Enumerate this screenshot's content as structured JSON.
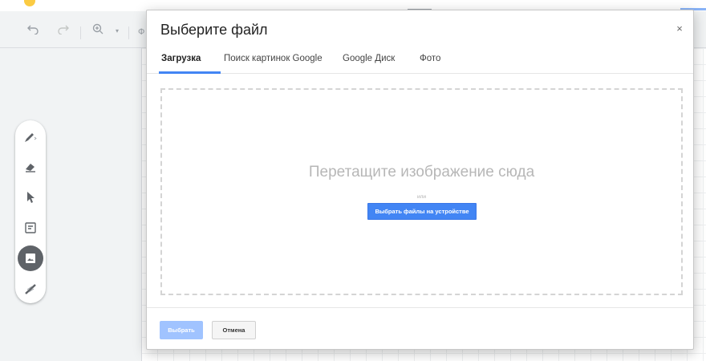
{
  "toolbar": {
    "undo_icon": "undo-icon",
    "redo_icon": "redo-icon",
    "zoom_icon": "zoom-icon",
    "font_letter": "Ф"
  },
  "tools": [
    "pen-icon",
    "eraser-icon",
    "select-arrow-icon",
    "sticky-note-icon",
    "image-icon",
    "laser-icon"
  ],
  "dialog": {
    "title": "Выберите файл",
    "close": "×",
    "tabs": [
      {
        "label": "Загрузка",
        "active": true
      },
      {
        "label": "Поиск картинок Google",
        "active": false
      },
      {
        "label": "Google Диск",
        "active": false
      },
      {
        "label": "Фото",
        "active": false
      }
    ],
    "dropzone": {
      "title": "Перетащите изображение сюда",
      "or": "или",
      "button": "Выбрать файлы на устройстве"
    },
    "footer": {
      "select": "Выбрать",
      "cancel": "Отмена"
    }
  },
  "colors": {
    "accent": "#4285f4",
    "disabled_accent": "#a0c3ff"
  }
}
